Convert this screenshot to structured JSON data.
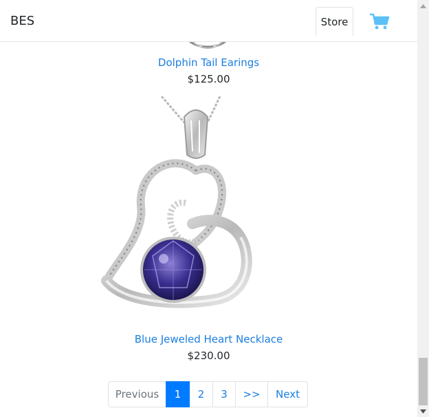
{
  "navbar": {
    "brand": "BES",
    "store_label": "Store",
    "cart_icon": "shopping-cart-icon",
    "cart_color": "#5bc0f8"
  },
  "products": [
    {
      "name": "Dolphin Tail Earings",
      "price": "$125.00",
      "image": "earrings-image"
    },
    {
      "name": "Blue Jeweled Heart Necklace",
      "price": "$230.00",
      "image": "heart-necklace-image"
    }
  ],
  "pagination": {
    "previous": "Previous",
    "pages": [
      "1",
      "2",
      "3"
    ],
    "active_page": "1",
    "skip": ">>",
    "next": "Next"
  },
  "colors": {
    "link": "#1a7ee0",
    "active_page_bg": "#007bff",
    "gem": "#3a2f8f"
  }
}
